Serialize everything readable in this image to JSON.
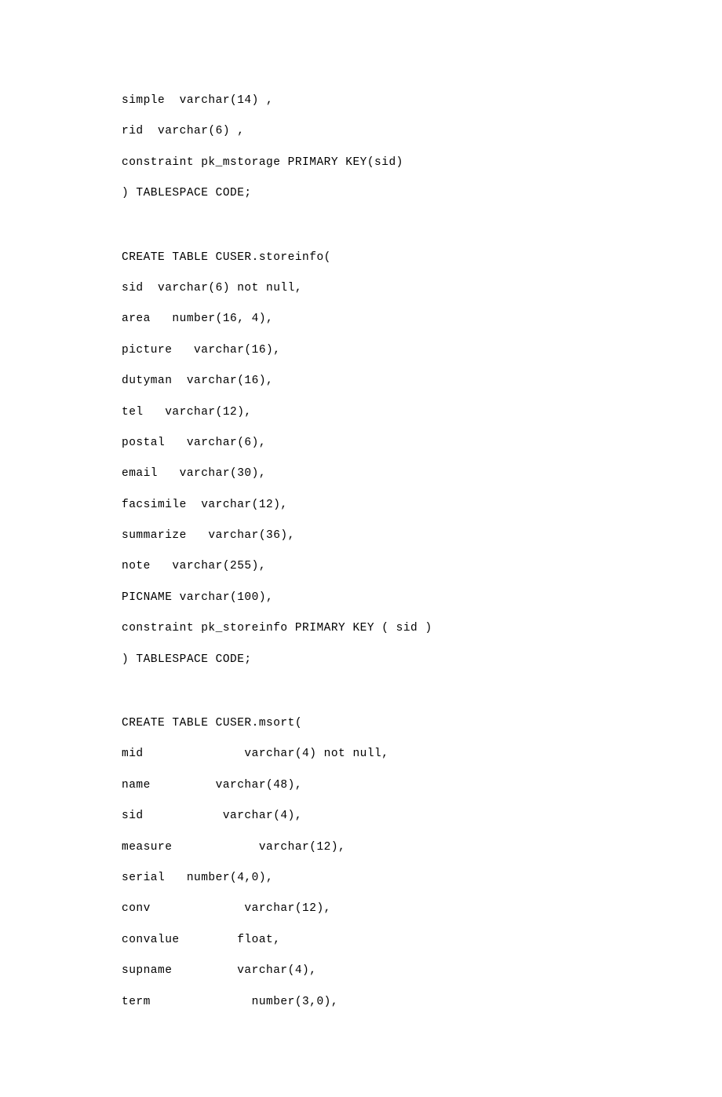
{
  "lines": [
    "simple  varchar(14) ,",
    "rid  varchar(6) ,",
    "constraint pk_mstorage PRIMARY KEY(sid)",
    ") TABLESPACE CODE;",
    "",
    "CREATE TABLE CUSER.storeinfo(",
    "sid  varchar(6) not null,",
    "area   number(16, 4),",
    "picture   varchar(16),",
    "dutyman  varchar(16),",
    "tel   varchar(12),",
    "postal   varchar(6),",
    "email   varchar(30),",
    "facsimile  varchar(12),",
    "summarize   varchar(36),",
    "note   varchar(255),",
    "PICNAME varchar(100),",
    "constraint pk_storeinfo PRIMARY KEY ( sid )",
    ") TABLESPACE CODE;",
    "",
    "CREATE TABLE CUSER.msort(",
    "mid              varchar(4) not null,",
    "name         varchar(48),",
    "sid           varchar(4),",
    "measure            varchar(12),",
    "serial   number(4,0),",
    "conv             varchar(12),",
    "convalue        float,",
    "supname         varchar(4),",
    "term              number(3,0),"
  ]
}
